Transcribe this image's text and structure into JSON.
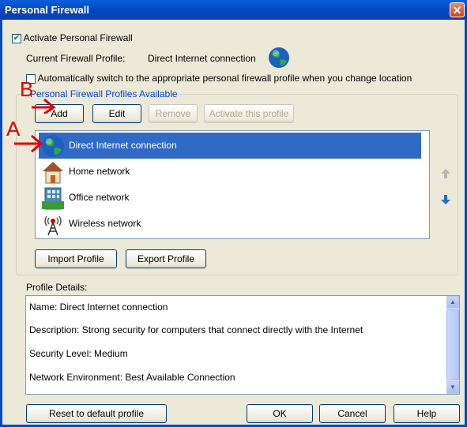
{
  "window": {
    "title": "Personal Firewall",
    "close_icon": "close-icon"
  },
  "activate": {
    "label": "Activate Personal Firewall",
    "checked": true
  },
  "current_profile": {
    "label": "Current Firewall Profile:",
    "value": "Direct Internet connection",
    "icon": "globe-icon"
  },
  "auto_switch": {
    "label": "Automatically switch to the appropriate personal firewall profile when you change location",
    "checked": false
  },
  "profiles_group": {
    "title": "Personal Firewall Profiles Available",
    "buttons": {
      "add": "Add",
      "edit": "Edit",
      "remove": "Remove",
      "activate": "Activate this profile"
    },
    "items": [
      {
        "label": "Direct Internet connection",
        "icon": "globe-icon",
        "selected": true
      },
      {
        "label": "Home network",
        "icon": "house-icon",
        "selected": false
      },
      {
        "label": "Office network",
        "icon": "office-building-icon",
        "selected": false
      },
      {
        "label": "Wireless network",
        "icon": "wireless-tower-icon",
        "selected": false
      }
    ],
    "move_up_icon": "arrow-up-icon",
    "move_down_icon": "arrow-down-icon",
    "import_label": "Import Profile",
    "export_label": "Export Profile"
  },
  "details": {
    "label": "Profile Details:",
    "lines": [
      "Name: Direct Internet connection",
      "Description: Strong security for computers that connect directly with the Internet",
      "Security Level: Medium",
      "Network Environment: Best Available Connection"
    ]
  },
  "footer": {
    "reset": "Reset to default profile",
    "ok": "OK",
    "cancel": "Cancel",
    "help": "Help"
  },
  "annotations": {
    "a": "A",
    "b": "B"
  },
  "colors": {
    "annotation": "#e00000",
    "selection": "#316ac5",
    "titlebar": "#0348c5"
  }
}
